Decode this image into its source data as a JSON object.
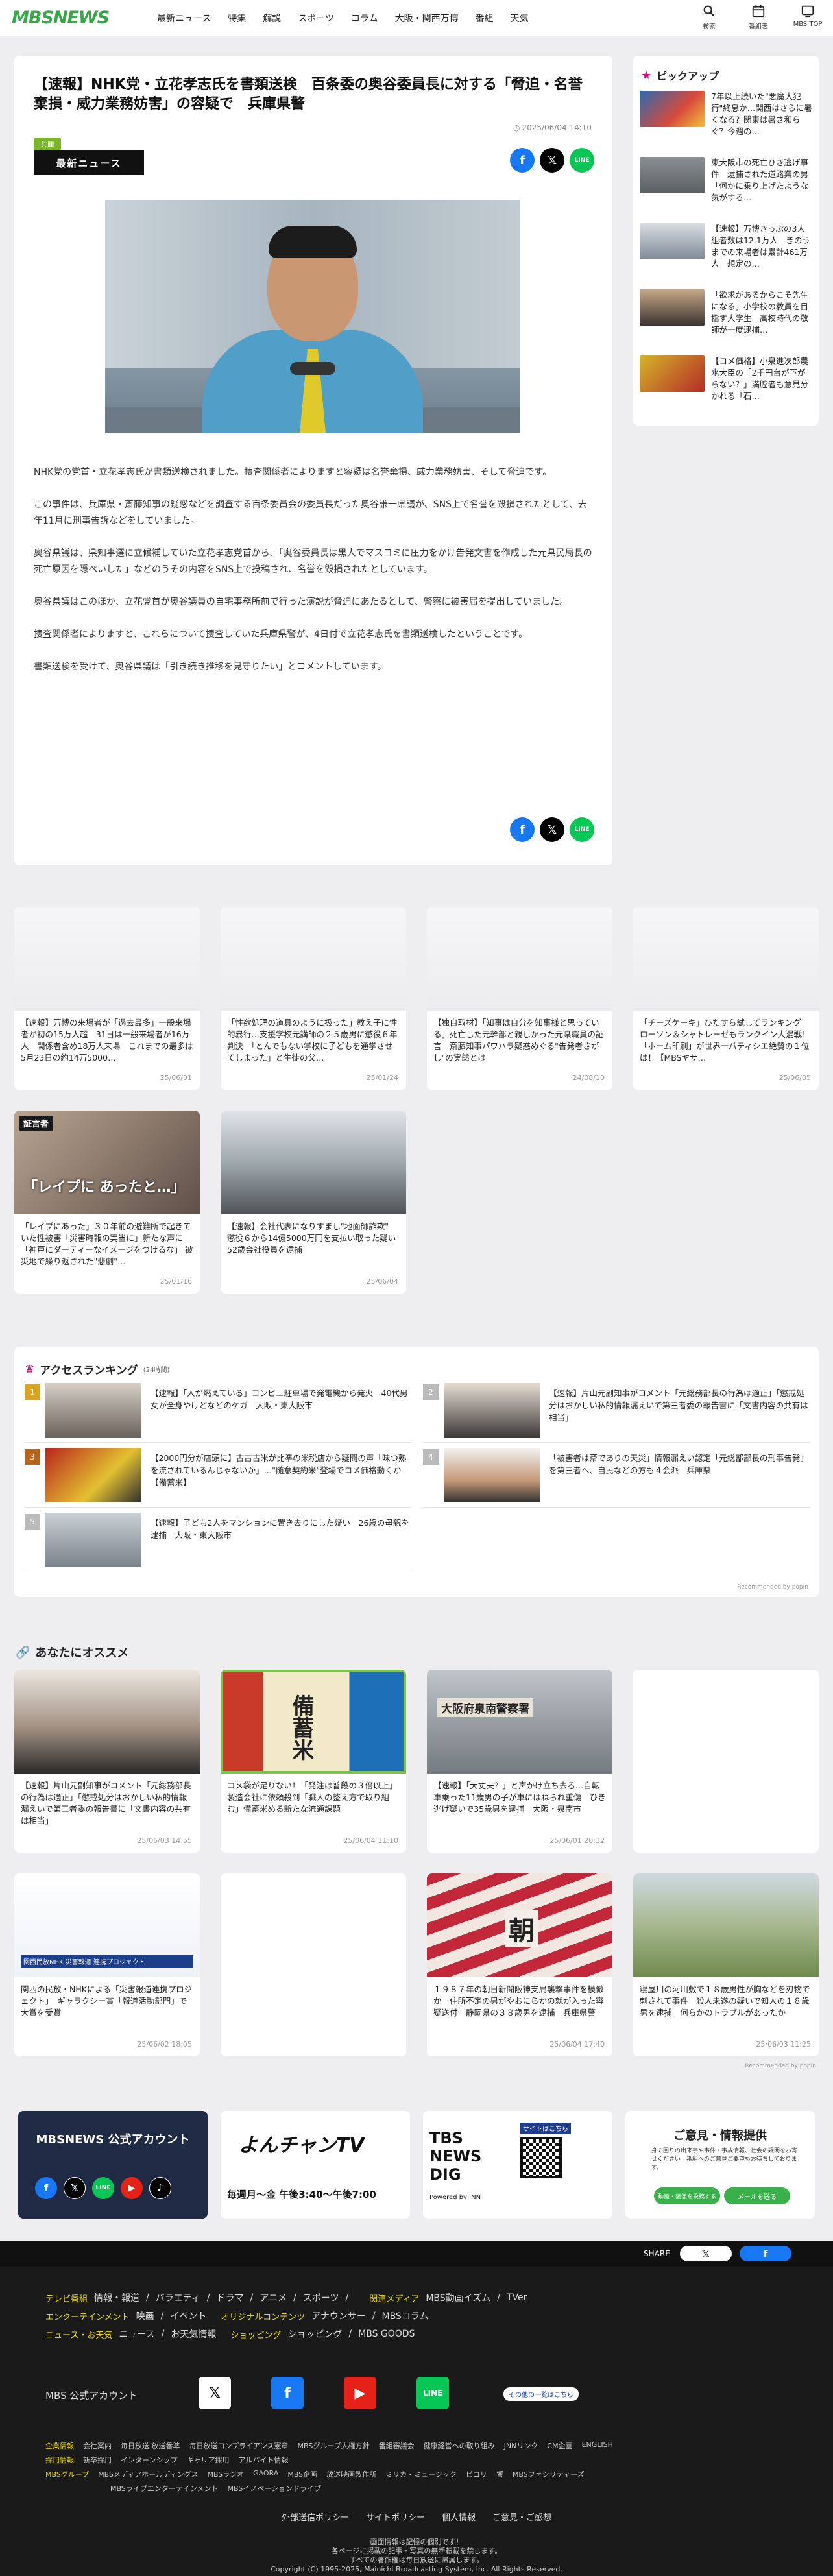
{
  "header": {
    "logo": "MBSNEWS",
    "nav": [
      "最新ニュース",
      "特集",
      "解説",
      "スポーツ",
      "コラム",
      "大阪・関西万博",
      "番組",
      "天気"
    ],
    "icons": [
      {
        "label": "検索",
        "icon": "search-icon"
      },
      {
        "label": "番組表",
        "icon": "calendar-icon"
      },
      {
        "label": "MBS TOP",
        "icon": "tv-icon"
      }
    ]
  },
  "article": {
    "title": "【速報】NHK党・立花孝志氏を書類送検　百条委の奥谷委員長に対する「脅迫・名誉棄損・威力業務妨害」の容疑で　兵庫県警",
    "tag": "兵庫",
    "date": "2025/06/04 14:10",
    "ribbon": "最新ニュース",
    "paragraphs": [
      "NHK党の党首・立花孝志氏が書類送検されました。捜査関係者によりますと容疑は名誉棄損、威力業務妨害、そして脅迫です。",
      "この事件は、兵庫県・斎藤知事の疑惑などを調査する百条委員会の委員長だった奥谷謙一県議が、SNS上で名誉を毀損されたとして、去年11月に刑事告訴などをしていました。",
      "奥谷県議は、県知事選に立候補していた立花孝志党首から、「奥谷委員長は黒人でマスコミに圧力をかけ告発文書を作成した元県民局長の死亡原因を隠ぺいした」などのうその内容をSNS上で投稿され、名誉を毀損されたとしています。",
      "奥谷県議はこのほか、立花党首が奥谷議員の自宅事務所前で行った演説が脅迫にあたるとして、警察に被害届を提出していました。",
      "捜査関係者によりますと、これらについて捜査していた兵庫県警が、4日付で立花孝志氏を書類送検したということです。",
      "書類送検を受けて、奥谷県議は「引き続き推移を見守りたい」とコメントしています。"
    ]
  },
  "pickup": {
    "title": "ピックアップ",
    "items": [
      "7年以上続いた\"悪魔大犯行\"終息か…関西はさらに暑くなる？関東は暑さ和らぐ？今週の…",
      "東大阪市の死亡ひき逃げ事件　逮捕された道路業の男「何かに乗り上げたような気がする…",
      "【速報】万博きっぷの3人組者数は12.1万人　きのうまでの来場者は累計461万人　想定の…",
      "「欲求があるからこそ先生になる」小学校の教員を目指す大学生　高校時代の敬師が一度逮捕…",
      "【コメ価格】小泉進次郎農水大臣の「2千円台が下がらない？」満腔者も意見分かれる「石…"
    ]
  },
  "related": [
    {
      "text": "【速報】万博の来場者が「過去最多」一般来場者が初の15万人超　31日は一般来場者が16万人　関係者含め18万人来場　これまでの最多は5月23日の約14万5000…",
      "date": "25/06/01"
    },
    {
      "text": "「性欲処理の道具のように扱った」教え子に性的暴行…支援学校元講師の２５歳男に懲役６年判決　「とんでもない学校に子どもを通学させてしまった」と生徒の父…",
      "date": "25/01/24"
    },
    {
      "text": "【独自取材】「知事は自分を知事様と思っている」死亡した元幹部と親しかった元県職員の証言　斎藤知事パワハラ疑惑めぐる\"告発者さがし\"の実態とは",
      "date": "24/08/10"
    },
    {
      "text": "「チーズケーキ」ひたすら試してランキング　ローソン＆シャトレーゼもランクイン大混戦！「ホーム印刷」が世界一パティシエ絶賛の１位は！【MBSヤサ…",
      "date": "25/06/05"
    },
    {
      "text": "「レイプにあった」３０年前の避難所で起きていた性被害「災害時報の実当に」新たな声に「神戸にダーティーなイメージをつけるな」 被災地で繰り返された\"悲劇\"…",
      "date": "25/01/16",
      "thumb_text": "「レイプに あったと…」",
      "thumb_label": "証言者"
    },
    {
      "text": "【速報】会社代表になりすまし\"地面師詐欺\"　懲役６から14億5000万円を支払い取った疑い　52歳会社役員を逮捕",
      "date": "25/06/04"
    }
  ],
  "ranking": {
    "title": "アクセスランキング",
    "subtitle": "(24時間)",
    "items": [
      {
        "rank": "1",
        "text": "【速報】「人が燃えている」コンビニ駐車場で発電機から発火　40代男女が全身やけどなどのケガ　大阪・東大阪市"
      },
      {
        "rank": "2",
        "text": "【速報】片山元副知事がコメント「元総務部長の行為は適正」「懲戒処分はおかしい私的情報漏えいで第三者委の報告書に「文書内容の共有は相当」"
      },
      {
        "rank": "3",
        "text": "【2000円分が店頭に】古古古米が比準の米税店から疑問の声「味つ熟を流されているんじゃないか」…\"随意契約米\"登場でコメ価格動くか【備蓄米】"
      },
      {
        "rank": "4",
        "text": "「被害者は斎でありの天災」情報漏えい認定「元総部部長の刑事告発」を第三者へ、自民などの方も４会派　兵庫県"
      },
      {
        "rank": "5",
        "text": "【速報】子ども2人をマンションに置き去りにした疑い　26歳の母親を逮捕　大阪・東大阪市"
      }
    ],
    "recommended": "Recommended by popIn"
  },
  "osusume": {
    "title": "あなたにオススメ",
    "items": [
      {
        "text": "【速報】片山元副知事がコメント「元総務部長の行為は適正」「懲戒処分はおかしい私的情報漏えいで第三者委の報告書に「文書内容の共有は相当」",
        "date": "25/06/03 14:55"
      },
      {
        "text": "コメ袋が足りない！「発注は普段の３倍以上」製造会社に依頼殺到「職人の整え方で取り組む」備蓄米める新たな流通課題",
        "date": "25/06/04 11:10",
        "thumb_text": "備蓄米"
      },
      {
        "text": "【速報】「大丈夫？」と声かけ立ち去る…自転車乗った11歳男の子が車にはねられ重傷　ひき逃げ疑いで35歳男を逮捕　大阪・泉南市",
        "date": "25/06/01 20:32",
        "thumb_text": "大阪府泉南警察署"
      },
      {
        "text": "",
        "date": ""
      },
      {
        "text": "関西の民放・NHKによる「災害報道連携プロジェクト」　ギャラクシー賞「報道活動部門」で大賞を受賞",
        "date": "25/06/02 18:05",
        "thumb_text": "関西民放NHK 災害報道 連携プロジェクト"
      },
      {
        "text": "",
        "date": ""
      },
      {
        "text": "１９８７年の朝日新聞阪神支局襲撃事件を模倣か　住所不定の男がやおにらかの就が入った容疑送付　静岡県の３８歳男を逮捕　兵庫県警",
        "date": "25/06/04 17:40",
        "thumb_text": "朝"
      },
      {
        "text": "寝屋川の河川敷で１８歳男性が胸などを刃物で刺されて事件　殺人未遂の疑いで知人の１８歳男を逮捕　何らかのトラブルがあったか",
        "date": "25/06/03 11:25"
      }
    ],
    "recommended": "Recommended by popIn"
  },
  "banners": {
    "mbs_official": "MBSNEWS 公式アカウント",
    "yonchan": "よんチャンTV",
    "yonchan_time": "毎週月〜金 午後3:40〜午後7:00",
    "tbs": "TBS NEWS DIG",
    "tbs_sub": "Powered by JNN",
    "tbs_qr_label": "サイトはこちら",
    "opinion_title": "ご意見・情報提供",
    "opinion_text": "身の回りの出来事や事件・事故情報、社会の疑問をお寄せください。番組へのご意見ご要望もお待ちしております。",
    "opinion_btn1": "動画・画像を投稿する",
    "opinion_btn2": "メールを送る"
  },
  "sharebar": {
    "label": "SHARE"
  },
  "footer": {
    "row1_label": "テレビ番組",
    "row1": [
      "情報・報道",
      "バラエティ",
      "ドラマ",
      "アニメ",
      "スポーツ"
    ],
    "row1b_label": "関連メディア",
    "row1b": [
      "MBS動画イズム",
      "TVer"
    ],
    "row2_label": "エンターテインメント",
    "row2": [
      "映画",
      "イベント"
    ],
    "row2b_label": "オリジナルコンテンツ",
    "row2b": [
      "アナウンサー",
      "MBSコラム"
    ],
    "row3_label": "ニュース・お天気",
    "row3": [
      "ニュース",
      "お天気情報"
    ],
    "row3b_label": "ショッピング",
    "row3b": [
      "ショッピング",
      "MBS GOODS"
    ],
    "official_label": "MBS 公式アカウント",
    "more_btn": "その他の一覧はこちら",
    "corp_label": "企業情報",
    "corp": [
      "会社案内",
      "毎日放送 放送番準",
      "毎日放送コンプライアンス憲章",
      "MBSグループ人権方針",
      "番組審議会",
      "健康経営への取り組み",
      "JNNリンク",
      "CM企画",
      "ENGLISH"
    ],
    "recruit_label": "採用情報",
    "recruit": [
      "新卒採用",
      "インターンシップ",
      "キャリア採用",
      "アルバイト情報"
    ],
    "group_label": "MBSグループ",
    "group": [
      "MBSメディアホールディングス",
      "MBSラジオ",
      "GAORA",
      "MBS企画",
      "放送映画製作所",
      "ミリカ・ミュージック",
      "ピコリ",
      "響",
      "MBSファシリティーズ"
    ],
    "group2": [
      "MBSライブエンターテインメント",
      "MBSイノベーションドライブ"
    ],
    "policy": [
      "外部送信ポリシー",
      "サイトポリシー",
      "個人情報",
      "ご意見・ご感想"
    ],
    "notice1": "画面情報は記憶の個別です！",
    "notice2": "各ページに掲載の記事・写真の無断転載を禁じます。",
    "notice3": "すべての著作権は毎日放送に帰属します。",
    "copyright": "Copyright (C) 1995-2025, Mainichi Broadcasting System, Inc. All Rights Reserved."
  }
}
